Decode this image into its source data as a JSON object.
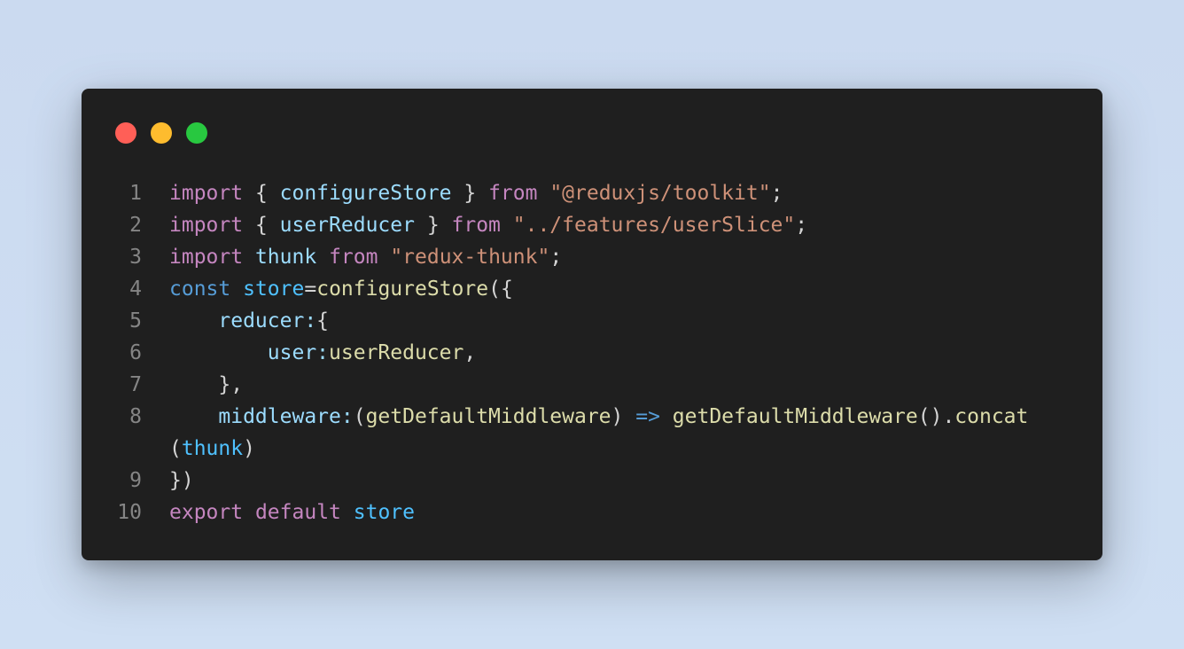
{
  "window": {
    "controls": [
      {
        "name": "close",
        "color": "#ff5f57"
      },
      {
        "name": "minimize",
        "color": "#febc2e"
      },
      {
        "name": "maximize",
        "color": "#28c840"
      }
    ]
  },
  "colors": {
    "keyword": "#c586c0",
    "storage": "#569cd6",
    "variable": "#9cdcfe",
    "constant": "#4fc1ff",
    "function": "#dcdcaa",
    "string": "#ce9178",
    "punct": "#d4d4d4",
    "operator": "#569cd6",
    "line_number": "#858585"
  },
  "code_lines": [
    {
      "n": "1",
      "tokens": [
        {
          "t": "import",
          "c": "keyword"
        },
        {
          "t": " { ",
          "c": "punct"
        },
        {
          "t": "configureStore",
          "c": "variable"
        },
        {
          "t": " } ",
          "c": "punct"
        },
        {
          "t": "from",
          "c": "keyword"
        },
        {
          "t": " ",
          "c": "punct"
        },
        {
          "t": "\"@reduxjs/toolkit\"",
          "c": "string"
        },
        {
          "t": ";",
          "c": "punct"
        }
      ]
    },
    {
      "n": "2",
      "tokens": [
        {
          "t": "import",
          "c": "keyword"
        },
        {
          "t": " { ",
          "c": "punct"
        },
        {
          "t": "userReducer",
          "c": "variable"
        },
        {
          "t": " } ",
          "c": "punct"
        },
        {
          "t": "from",
          "c": "keyword"
        },
        {
          "t": " ",
          "c": "punct"
        },
        {
          "t": "\"../features/userSlice\"",
          "c": "string"
        },
        {
          "t": ";",
          "c": "punct"
        }
      ]
    },
    {
      "n": "3",
      "tokens": [
        {
          "t": "import",
          "c": "keyword"
        },
        {
          "t": " ",
          "c": "punct"
        },
        {
          "t": "thunk",
          "c": "variable"
        },
        {
          "t": " ",
          "c": "punct"
        },
        {
          "t": "from",
          "c": "keyword"
        },
        {
          "t": " ",
          "c": "punct"
        },
        {
          "t": "\"redux-thunk\"",
          "c": "string"
        },
        {
          "t": ";",
          "c": "punct"
        }
      ]
    },
    {
      "n": "4",
      "tokens": [
        {
          "t": "const",
          "c": "storage"
        },
        {
          "t": " ",
          "c": "punct"
        },
        {
          "t": "store",
          "c": "constant"
        },
        {
          "t": "=",
          "c": "punct"
        },
        {
          "t": "configureStore",
          "c": "function"
        },
        {
          "t": "({",
          "c": "punct"
        }
      ]
    },
    {
      "n": "5",
      "tokens": [
        {
          "t": "    ",
          "c": "punct"
        },
        {
          "t": "reducer:",
          "c": "variable"
        },
        {
          "t": "{",
          "c": "punct"
        }
      ]
    },
    {
      "n": "6",
      "tokens": [
        {
          "t": "        ",
          "c": "punct"
        },
        {
          "t": "user:",
          "c": "variable"
        },
        {
          "t": "userReducer",
          "c": "function"
        },
        {
          "t": ",",
          "c": "punct"
        }
      ]
    },
    {
      "n": "7",
      "tokens": [
        {
          "t": "    },",
          "c": "punct"
        }
      ]
    },
    {
      "n": "8",
      "tokens": [
        {
          "t": "    ",
          "c": "punct"
        },
        {
          "t": "middleware:",
          "c": "variable"
        },
        {
          "t": "(",
          "c": "punct"
        },
        {
          "t": "getDefaultMiddleware",
          "c": "function"
        },
        {
          "t": ") ",
          "c": "punct"
        },
        {
          "t": "=>",
          "c": "operator"
        },
        {
          "t": " ",
          "c": "punct"
        },
        {
          "t": "getDefaultMiddleware",
          "c": "function"
        },
        {
          "t": "().",
          "c": "punct"
        },
        {
          "t": "concat",
          "c": "function"
        }
      ]
    },
    {
      "n": "",
      "tokens": [
        {
          "t": "(",
          "c": "punct"
        },
        {
          "t": "thunk",
          "c": "constant"
        },
        {
          "t": ")",
          "c": "punct"
        }
      ]
    },
    {
      "n": "9",
      "tokens": [
        {
          "t": "})",
          "c": "punct"
        }
      ]
    },
    {
      "n": "10",
      "tokens": [
        {
          "t": "export",
          "c": "keyword"
        },
        {
          "t": " ",
          "c": "punct"
        },
        {
          "t": "default",
          "c": "keyword"
        },
        {
          "t": " ",
          "c": "punct"
        },
        {
          "t": "store",
          "c": "constant"
        }
      ]
    }
  ]
}
